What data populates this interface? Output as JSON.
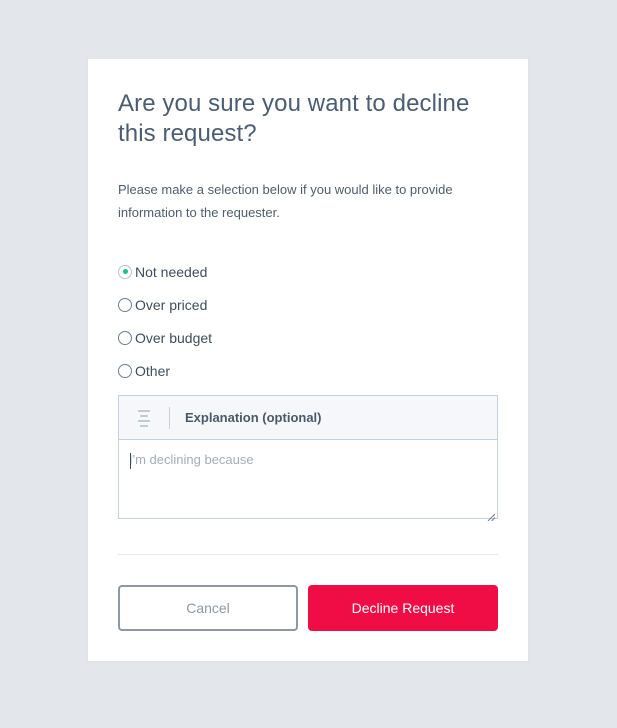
{
  "dialog": {
    "title": "Are you sure you want to decline this request?",
    "description": "Please make a selection below if you would like to provide information to the requester.",
    "options": [
      {
        "label": "Not needed",
        "selected": true
      },
      {
        "label": "Over priced",
        "selected": false
      },
      {
        "label": "Over budget",
        "selected": false
      },
      {
        "label": "Other",
        "selected": false
      }
    ],
    "explanation": {
      "label": "Explanation (optional)",
      "placeholder": "I'm declining because",
      "value": "",
      "icon": "text-align-center-icon"
    },
    "buttons": {
      "cancel_label": "Cancel",
      "decline_label": "Decline Request"
    }
  },
  "colors": {
    "background": "#e3e7eb",
    "card": "#ffffff",
    "accent_selected": "#19c37d",
    "decline_button": "#f00d45",
    "cancel_border": "#8e99a4"
  }
}
